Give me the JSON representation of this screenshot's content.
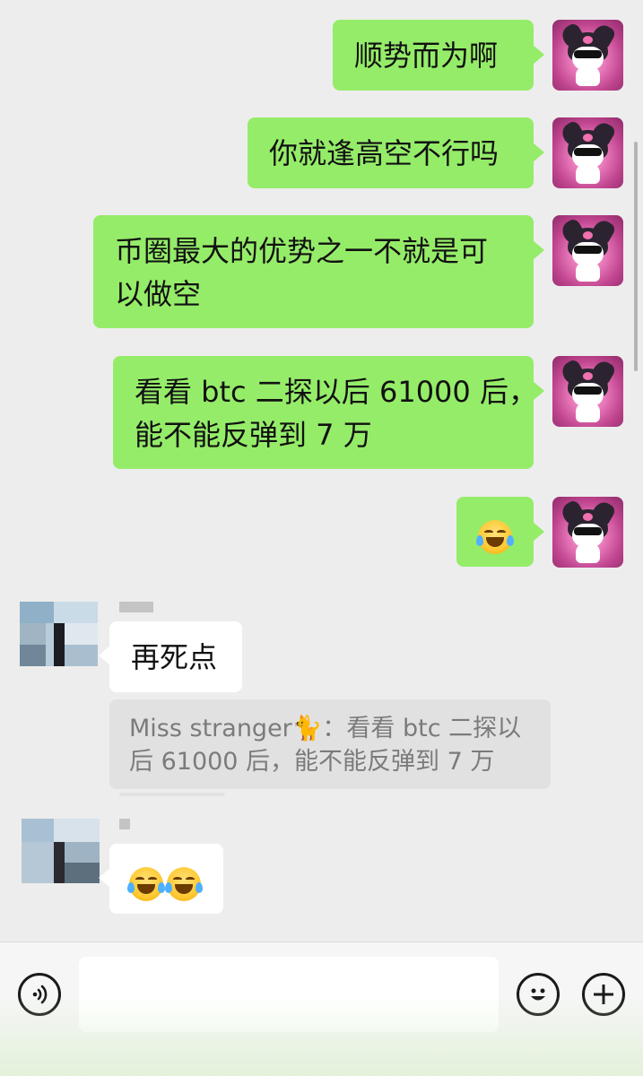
{
  "messages_out": [
    {
      "text": "顺势而为啊"
    },
    {
      "text": "你就逢高空不行吗"
    },
    {
      "text": "币圈最大的优势之一不就是可以做空"
    },
    {
      "text": "看看 btc 二探以后 61000 后，能不能反弹到 7 万"
    },
    {
      "emoji": "tears-of-joy"
    }
  ],
  "messages_in": [
    {
      "text": "再死点",
      "quote": "Miss stranger🐈：看看 btc 二探以后 61000 后，能不能反弹到 7 万"
    },
    {
      "emoji": [
        "tears-of-joy",
        "tears-of-joy"
      ]
    }
  ],
  "labels": {
    "msg1": "顺势而为啊",
    "msg2": "你就逢高空不行吗",
    "msg3_line1": "币圈最大的优势之一不就是可",
    "msg3_line2": "以做空",
    "msg4_line1": "看看 btc 二探以后 61000 后，",
    "msg4_line2": "能不能反弹到 7 万",
    "reply1": "再死点",
    "quote_line1": "Miss stranger🐈：看看 btc 二探以",
    "quote_line2": "后 61000 后，能不能反弹到 7 万"
  },
  "input": {
    "value": "",
    "placeholder": ""
  },
  "icons": {
    "voice": "voice-icon",
    "emoji": "emoji-icon",
    "plus": "plus-icon"
  },
  "colors": {
    "out_bubble": "#95ec69",
    "in_bubble": "#ffffff",
    "background": "#ededed"
  }
}
